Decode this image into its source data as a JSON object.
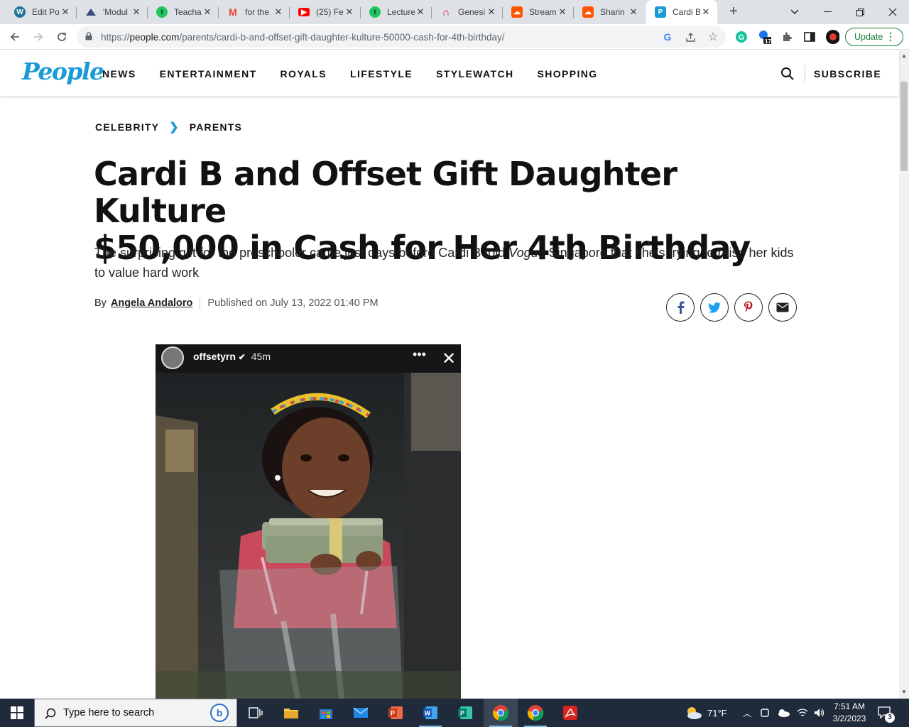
{
  "browser": {
    "tabs": [
      {
        "title": "Edit Po",
        "icon": "wordpress-icon",
        "color": "#21759b"
      },
      {
        "title": "'Modul",
        "icon": "boat-icon",
        "color": "#3b4b7a"
      },
      {
        "title": "Teacha",
        "icon": "teachable-icon",
        "color": "#22c55e"
      },
      {
        "title": "for the",
        "icon": "gmail-icon",
        "color": "#ea4335"
      },
      {
        "title": "(25) Fe",
        "icon": "youtube-icon",
        "color": "#ff0000"
      },
      {
        "title": "Lecture",
        "icon": "teachable-icon",
        "color": "#22c55e"
      },
      {
        "title": "Genesi",
        "icon": "headphones-icon",
        "color": "#c2185b"
      },
      {
        "title": "Stream",
        "icon": "soundcloud-icon",
        "color": "#ff5500"
      },
      {
        "title": "Sharin",
        "icon": "soundcloud-icon",
        "color": "#ff5500"
      },
      {
        "title": "Cardi B",
        "icon": "people-icon",
        "color": "#1a9ad6"
      }
    ],
    "url": "https://people.com/parents/cardi-b-and-offset-gift-daughter-kulture-50000-cash-for-4th-birthday/",
    "url_host": "people.com",
    "extension_badge": "17",
    "update_label": "Update"
  },
  "site": {
    "logo": "People",
    "nav": [
      "NEWS",
      "ENTERTAINMENT",
      "ROYALS",
      "LIFESTYLE",
      "STYLEWATCH",
      "SHOPPING"
    ],
    "subscribe": "SUBSCRIBE",
    "brand_color": "#1a9ad6"
  },
  "article": {
    "breadcrumb": [
      "CELEBRITY",
      "PARENTS"
    ],
    "headline_line1": "Cardi B and Offset Gift Daughter Kulture",
    "headline_line2": "$50,000 in Cash for Her 4th Birthday",
    "dek_before": "The surprising gift for the preschooler came just days before Cardi B told ",
    "dek_em": "Vogue",
    "dek_after": " Singapore that she’s trying to raise her kids to value hard work",
    "byline_prefix": "By",
    "author": "Angela Andaloro",
    "published": "Published on July 13, 2022 01:40 PM",
    "share": [
      "facebook-icon",
      "twitter-icon",
      "pinterest-icon",
      "email-icon"
    ],
    "story": {
      "username": "offsetyrn",
      "time": "45m"
    }
  },
  "taskbar": {
    "search_placeholder": "Type here to search",
    "weather": "71°F",
    "time": "7:51 AM",
    "date": "3/2/2023",
    "notifications": "3"
  }
}
